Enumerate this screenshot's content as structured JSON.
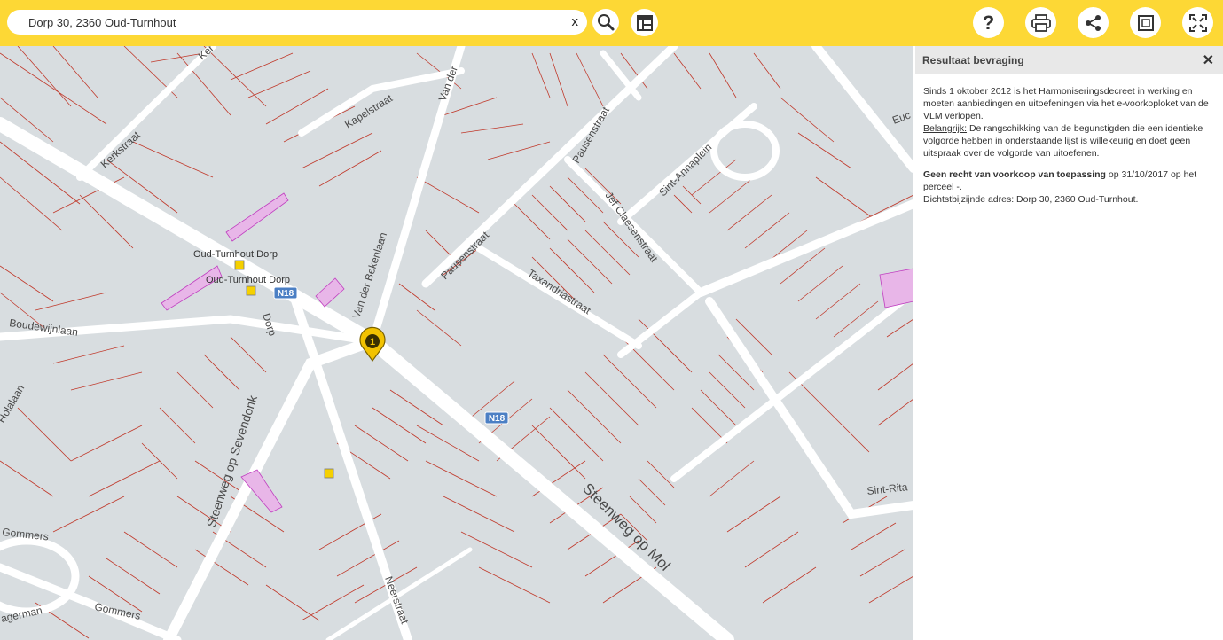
{
  "search": {
    "value": "Dorp 30, 2360 Oud-Turnhout",
    "clear_label": "x"
  },
  "toolbar": {
    "icons": [
      "search-icon",
      "layers-icon",
      "help-icon",
      "print-icon",
      "share-icon",
      "frame-icon",
      "fullscreen-icon"
    ],
    "help_label": "?"
  },
  "map": {
    "street_labels": {
      "kerkstraat_top": "Ker",
      "kerkstraat": "Kerkstraat",
      "kapelstraat": "Kapelstraat",
      "van_der_top": "Van der",
      "pausenstraat_top": "Pausenstraat",
      "pausenstraat": "Pausenstraat",
      "jef_claesenstraat": "Jef Claesenstraat",
      "sint_annaplein": "Sint-Annaplein",
      "taxandriastraat": "Taxandriastraat",
      "van_der_bekenlaan": "Van der Bekenlaan",
      "boudewijnlaan": "Boudewijnlaan",
      "dorp": "Dorp",
      "steenweg_op_sevendonk": "Steenweg op Sevendonk",
      "steenweg_op_mol": "Steenweg op Mol",
      "neerstraat": "Neerstraat",
      "gommers_1": "Gommers",
      "gommers_2": "Gommers",
      "agerman": "agerman",
      "holalaan": "Holalaan",
      "sint_rita": "Sint-Rita",
      "euc": "Euc"
    },
    "stops": [
      "Oud-Turnhout Dorp",
      "Oud-Turnhout Dorp"
    ],
    "road_shields": [
      "N18",
      "N18"
    ],
    "marker_number": "1",
    "colors": {
      "background": "#d8dde0",
      "road": "#ffffff",
      "parcel_line": "#c0392b",
      "highlight": "#e8b6e8",
      "marker": "#f2c200",
      "shield": "#4b7fc4"
    }
  },
  "panel": {
    "title": "Resultaat bevraging",
    "close_label": "✕",
    "intro": "Sinds 1 oktober 2012 is het Harmoniseringsdecreet in werking en moeten aanbiedingen en uitoefeningen via het e-voorkoploket van de VLM verlopen.",
    "important_label": "Belangrijk:",
    "important_text": " De rangschikking van de begunstigden die een identieke volgorde hebben in onderstaande lijst is willekeurig en doet geen uitspraak over de volgorde van uitoefenen.",
    "result_bold": "Geen recht van voorkoop van toepassing",
    "result_text": " op 31/10/2017 op het perceel -.",
    "address_text": "Dichtstbijzijnde adres: Dorp 30, 2360 Oud-Turnhout."
  }
}
